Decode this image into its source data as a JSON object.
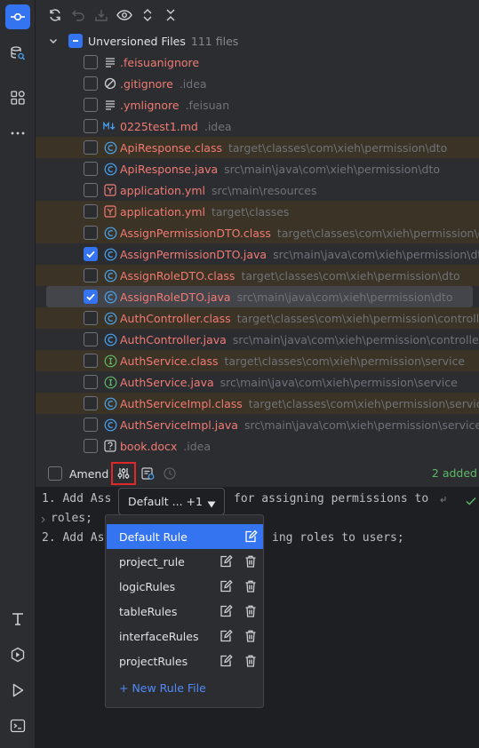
{
  "activity_bar": {
    "top": [
      "commit-icon",
      "database-search-icon",
      "plugins-icon",
      "more-icon"
    ],
    "bottom": [
      "text-tool-icon",
      "services-icon",
      "run-icon",
      "terminal-icon"
    ]
  },
  "toolbar": [
    "refresh-icon",
    "rollback-icon",
    "shelve-icon",
    "preview-icon",
    "expand-all-icon",
    "collapse-all-icon"
  ],
  "tree": {
    "group_label": "Unversioned Files",
    "group_count": "111 files",
    "files": [
      {
        "name": ".feisuanignore",
        "path": "",
        "icon": "text-file-icon",
        "checked": false,
        "state": ""
      },
      {
        "name": ".gitignore",
        "path": ".idea",
        "icon": "ignore-file-icon",
        "checked": false,
        "state": ""
      },
      {
        "name": ".ymlignore",
        "path": ".feisuan",
        "icon": "text-file-icon",
        "checked": false,
        "state": ""
      },
      {
        "name": "0225test1.md",
        "path": ".idea",
        "icon": "markdown-icon",
        "checked": false,
        "state": ""
      },
      {
        "name": "ApiResponse.class",
        "path": "target\\classes\\com\\xieh\\permission\\dto",
        "icon": "class-icon",
        "checked": false,
        "state": "hl"
      },
      {
        "name": "ApiResponse.java",
        "path": "src\\main\\java\\com\\xieh\\permission\\dto",
        "icon": "class-icon",
        "checked": false,
        "state": ""
      },
      {
        "name": "application.yml",
        "path": "src\\main\\resources",
        "icon": "yaml-icon",
        "checked": false,
        "state": ""
      },
      {
        "name": "application.yml",
        "path": "target\\classes",
        "icon": "yaml-icon",
        "checked": false,
        "state": "hl"
      },
      {
        "name": "AssignPermissionDTO.class",
        "path": "target\\classes\\com\\xieh\\permission\\dto",
        "icon": "class-icon",
        "checked": false,
        "state": "hl"
      },
      {
        "name": "AssignPermissionDTO.java",
        "path": "src\\main\\java\\com\\xieh\\permission\\dto",
        "icon": "class-icon",
        "checked": true,
        "state": ""
      },
      {
        "name": "AssignRoleDTO.class",
        "path": "target\\classes\\com\\xieh\\permission\\dto",
        "icon": "class-icon",
        "checked": false,
        "state": "hl"
      },
      {
        "name": "AssignRoleDTO.java",
        "path": "src\\main\\java\\com\\xieh\\permission\\dto",
        "icon": "class-icon",
        "checked": true,
        "state": "sel"
      },
      {
        "name": "AuthController.class",
        "path": "target\\classes\\com\\xieh\\permission\\controller",
        "icon": "class-icon",
        "checked": false,
        "state": "hl"
      },
      {
        "name": "AuthController.java",
        "path": "src\\main\\java\\com\\xieh\\permission\\controller",
        "icon": "class-icon",
        "checked": false,
        "state": ""
      },
      {
        "name": "AuthService.class",
        "path": "target\\classes\\com\\xieh\\permission\\service",
        "icon": "interface-icon",
        "checked": false,
        "state": "hl"
      },
      {
        "name": "AuthService.java",
        "path": "src\\main\\java\\com\\xieh\\permission\\service",
        "icon": "interface-icon",
        "checked": false,
        "state": ""
      },
      {
        "name": "AuthServiceImpl.class",
        "path": "target\\classes\\com\\xieh\\permission\\service\\im",
        "icon": "class-icon",
        "checked": false,
        "state": "hl"
      },
      {
        "name": "AuthServiceImpl.java",
        "path": "src\\main\\java\\com\\xieh\\permission\\service\\imp",
        "icon": "class-icon",
        "checked": false,
        "state": ""
      },
      {
        "name": "book.docx",
        "path": ".idea",
        "icon": "unknown-file-icon",
        "checked": false,
        "state": ""
      }
    ]
  },
  "commit": {
    "amend_label": "Amend",
    "added_status": "2 added"
  },
  "editor": {
    "line1a": "1. Add Ass",
    "line1b": "for assigning permissions to",
    "line1c": "roles;",
    "line2a": "2. Add Ass",
    "line2b": "ing roles to users;"
  },
  "rule_dropdown": {
    "selected": "Default ... +1",
    "rules": [
      "Default Rule",
      "project_rule",
      "logicRules",
      "tableRules",
      "interfaceRules",
      "projectRules"
    ],
    "new_rule": "+ New Rule File"
  },
  "colors": {
    "accent": "#3574f0",
    "unversioned_text": "#f27b74",
    "added_text": "#5fb865",
    "highlight_box": "#e0282a"
  }
}
